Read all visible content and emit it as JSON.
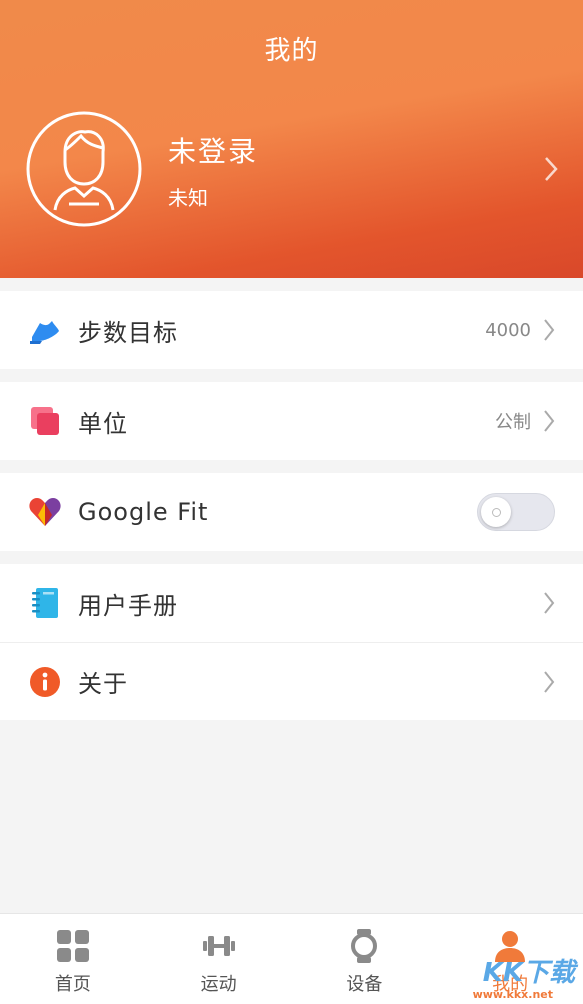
{
  "header": {
    "title": "我的",
    "user_name": "未登录",
    "user_sub": "未知"
  },
  "settings": {
    "step_goal": {
      "label": "步数目标",
      "value": "4000"
    },
    "unit": {
      "label": "单位",
      "value": "公制"
    },
    "google_fit": {
      "label": "Google Fit",
      "enabled": false
    },
    "manual": {
      "label": "用户手册"
    },
    "about": {
      "label": "关于"
    }
  },
  "tabs": [
    {
      "label": "首页",
      "icon": "grid-icon",
      "active": false
    },
    {
      "label": "运动",
      "icon": "dumbbell-icon",
      "active": false
    },
    {
      "label": "设备",
      "icon": "watch-icon",
      "active": false
    },
    {
      "label": "我的",
      "icon": "person-icon",
      "active": true
    }
  ],
  "watermark": {
    "text": "KK下载",
    "sub": "www.kkx.net"
  },
  "colors": {
    "accent": "#f07a3a",
    "header_start": "#f08a4a",
    "header_end": "#d9482a"
  }
}
